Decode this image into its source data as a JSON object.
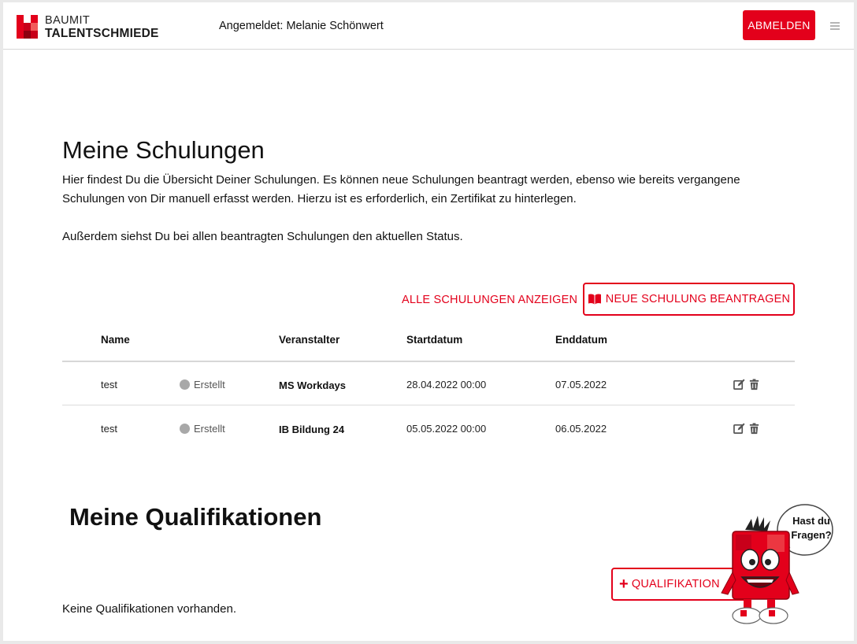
{
  "header": {
    "logo": {
      "line1": "BAUMIT",
      "line2": "TALENTSCHMIEDE"
    },
    "logged_in_text": "Angemeldet: Melanie Schönwert",
    "logout_label": "ABMELDEN"
  },
  "trainings": {
    "title": "Meine Schulungen",
    "intro": "Hier findest Du die Übersicht Deiner Schulungen. Es können neue Schulungen beantragt werden, ebenso wie bereits vergangene Schulungen von Dir manuell erfasst werden. Hierzu ist es erforderlich, ein Zertifikat zu hinterlegen.",
    "intro2": "Außerdem siehst Du bei allen beantragten Schulungen den aktuellen Status.",
    "show_all_label": "ALLE SCHULUNGEN ANZEIGEN",
    "new_training_label": "NEUE SCHULUNG BEANTRAGEN",
    "columns": {
      "name": "Name",
      "organizer": "Veranstalter",
      "start": "Startdatum",
      "end": "Enddatum"
    },
    "rows": [
      {
        "name": "test",
        "status": "Erstellt",
        "organizer": "MS Workdays",
        "start": "28.04.2022 00:00",
        "end": "07.05.2022"
      },
      {
        "name": "test",
        "status": "Erstellt",
        "organizer": "IB Bildung 24",
        "start": "05.05.2022 00:00",
        "end": "06.05.2022"
      }
    ]
  },
  "qualifications": {
    "title": "Meine Qualifikationen",
    "add_label": "QUALIFIKATION",
    "empty_text": "Keine Qualifikationen vorhanden."
  },
  "help": {
    "bubble_line1": "Hast du",
    "bubble_line2": "Fragen?"
  },
  "colors": {
    "accent": "#e3001b",
    "status_dot": "#a8a8a8"
  },
  "icons": [
    "menu-icon",
    "book-icon",
    "edit-icon",
    "trash-icon",
    "plus-icon",
    "status-dot-icon"
  ]
}
